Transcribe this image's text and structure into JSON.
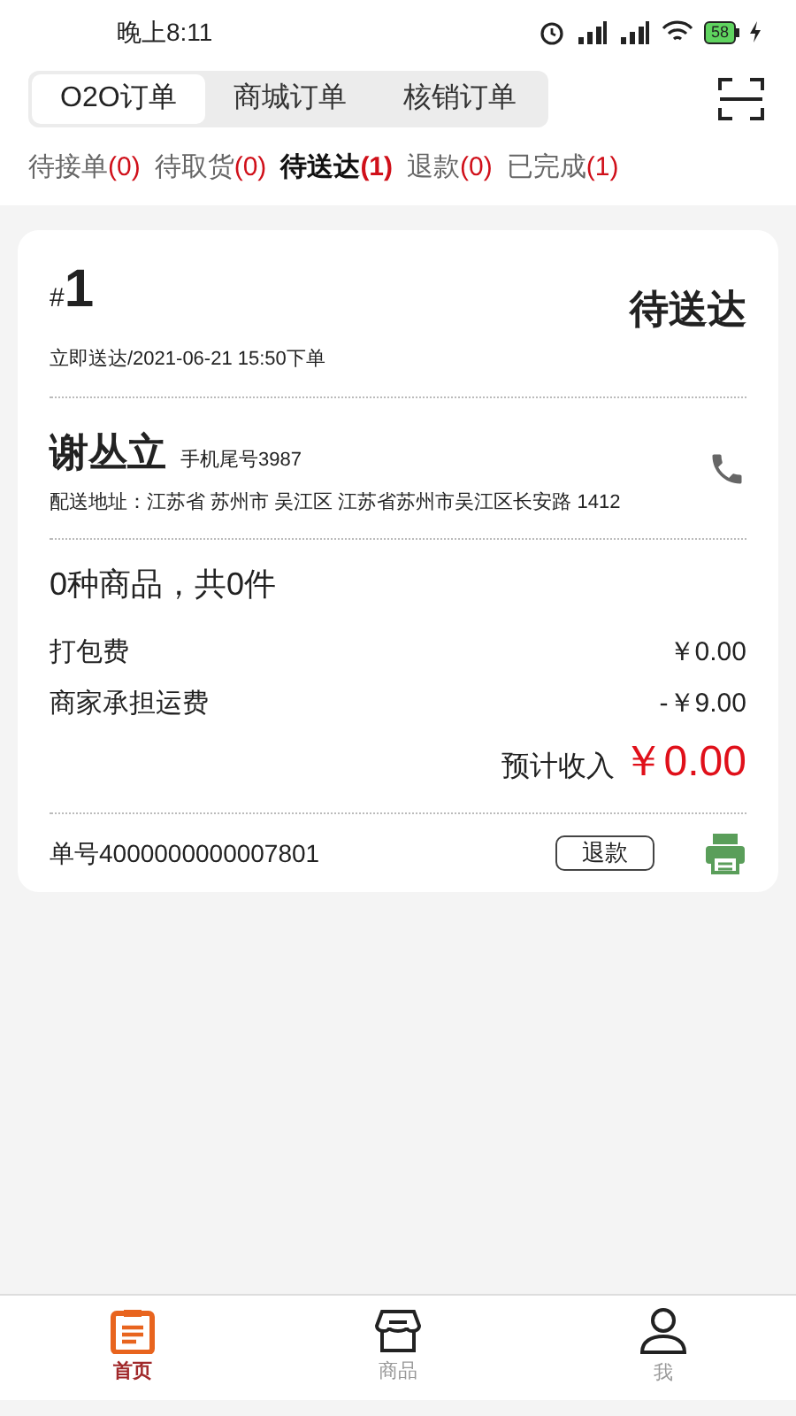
{
  "status_bar": {
    "time": "晚上8:11",
    "battery": "58"
  },
  "segments": [
    {
      "label": "O2O订单",
      "selected": true
    },
    {
      "label": "商城订单",
      "selected": false
    },
    {
      "label": "核销订单",
      "selected": false
    }
  ],
  "filters": [
    {
      "label": "待接单",
      "count": "(0)",
      "selected": false
    },
    {
      "label": "待取货",
      "count": "(0)",
      "selected": false
    },
    {
      "label": "待送达",
      "count": "(1)",
      "selected": true
    },
    {
      "label": "退款",
      "count": "(0)",
      "selected": false
    },
    {
      "label": "已完成",
      "count": "(1)",
      "selected": false
    }
  ],
  "order": {
    "hash": "#",
    "number": "1",
    "status": "待送达",
    "placed": "立即送达/2021-06-21 15:50下单",
    "customer": "谢丛立",
    "phone": "手机尾号3987",
    "address": "配送地址：江苏省 苏州市 吴江区 江苏省苏州市吴江区长安路 1412",
    "summary": "0种商品，共0件",
    "fees": [
      {
        "label": "打包费",
        "value": "￥0.00"
      },
      {
        "label": "商家承担运费",
        "value": "-￥9.00"
      }
    ],
    "income_label": "预计收入",
    "income": "￥0.00",
    "order_no": "单号4000000000007801",
    "refund": "退款"
  },
  "nav": [
    {
      "kind": "home",
      "label": "首页",
      "selected": true
    },
    {
      "kind": "goods",
      "label": "商品",
      "selected": false
    },
    {
      "kind": "me",
      "label": "我",
      "selected": false
    }
  ]
}
